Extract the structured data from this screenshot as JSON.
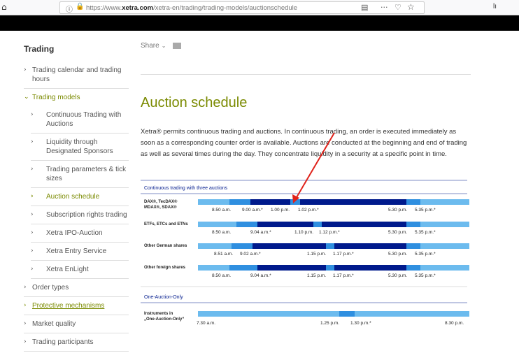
{
  "browser": {
    "url_prefix": "https://www.",
    "url_domain": "xetra.com",
    "url_path": "/xetra-en/trading/trading-models/auctionschedule",
    "icons": [
      "home-icon",
      "info-icon",
      "lock-icon",
      "reader-icon",
      "more-icon",
      "pocket-icon",
      "star-icon",
      "library-icon"
    ]
  },
  "sidebar": {
    "title": "Trading",
    "items": [
      {
        "label": "Trading calendar and trading hours"
      },
      {
        "label": "Trading models"
      },
      {
        "label": "Continuous Trading with Auctions"
      },
      {
        "label": "Liquidity through Designated Sponsors"
      },
      {
        "label": "Trading parameters & tick sizes"
      },
      {
        "label": "Auction schedule"
      },
      {
        "label": "Subscription rights trading"
      },
      {
        "label": "Xetra IPO-Auction"
      },
      {
        "label": "Xetra Entry Service"
      },
      {
        "label": "Xetra EnLight"
      },
      {
        "label": "Order types"
      },
      {
        "label": "Protective mechanisms"
      },
      {
        "label": "Market quality"
      },
      {
        "label": "Trading participants"
      }
    ]
  },
  "main": {
    "share_label": "Share",
    "title": "Auction schedule",
    "intro": "Xetra® permits continuous trading and auctions. In continuous trading, an order is executed immediately as soon as a corresponding counter order is available. Auctions are conducted at the beginning and end of trading as well as several times during the day. They concentrate liquidity in a security at a specific point in time."
  },
  "colors": {
    "accent": "#7a8a00",
    "light_blue": "#6cbbee",
    "mid_blue": "#2f8fe0",
    "dark_blue": "#001a8c",
    "section_heading": "#001a8c"
  },
  "schedule": {
    "section1_title": "Continuous trading with three auctions",
    "rows": [
      {
        "label1": "DAX®, TecDAX®",
        "label2": "MDAX®, SDAX®",
        "times": [
          "8.50 a.m.",
          "9.00 a.m.*",
          "1.00 p.m.",
          "1.02 p.m.*",
          "5.30 p.m.",
          "5.35 p.m.*"
        ]
      },
      {
        "label1": "ETFs, ETCs and ETNs",
        "label2": "",
        "times": [
          "8.50 a.m.",
          "9.04 a.m.*",
          "1.10 p.m.",
          "1.12 p.m.*",
          "5.30 p.m.",
          "5.35 p.m.*"
        ]
      },
      {
        "label1": "Other German shares",
        "label2": "",
        "times": [
          "8.51 a.m.",
          "9.02 a.m.*",
          "1.15 p.m.",
          "1.17 p.m.*",
          "5.30 p.m.",
          "5.35 p.m.*"
        ]
      },
      {
        "label1": "Other foreign shares",
        "label2": "",
        "times": [
          "8.50 a.m.",
          "9.04 a.m.*",
          "1.15 p.m.",
          "1.17 p.m.*",
          "5.30 p.m.",
          "5.35 p.m.*"
        ]
      }
    ],
    "section2_title": "One-Auction-Only",
    "one_auction": {
      "label1": "Instruments in",
      "label2": "„One-Auction-Only“",
      "times": [
        "7.30 a.m.",
        "1.25 p.m.",
        "1.30 p.m.*",
        "8.30 p.m."
      ]
    }
  }
}
